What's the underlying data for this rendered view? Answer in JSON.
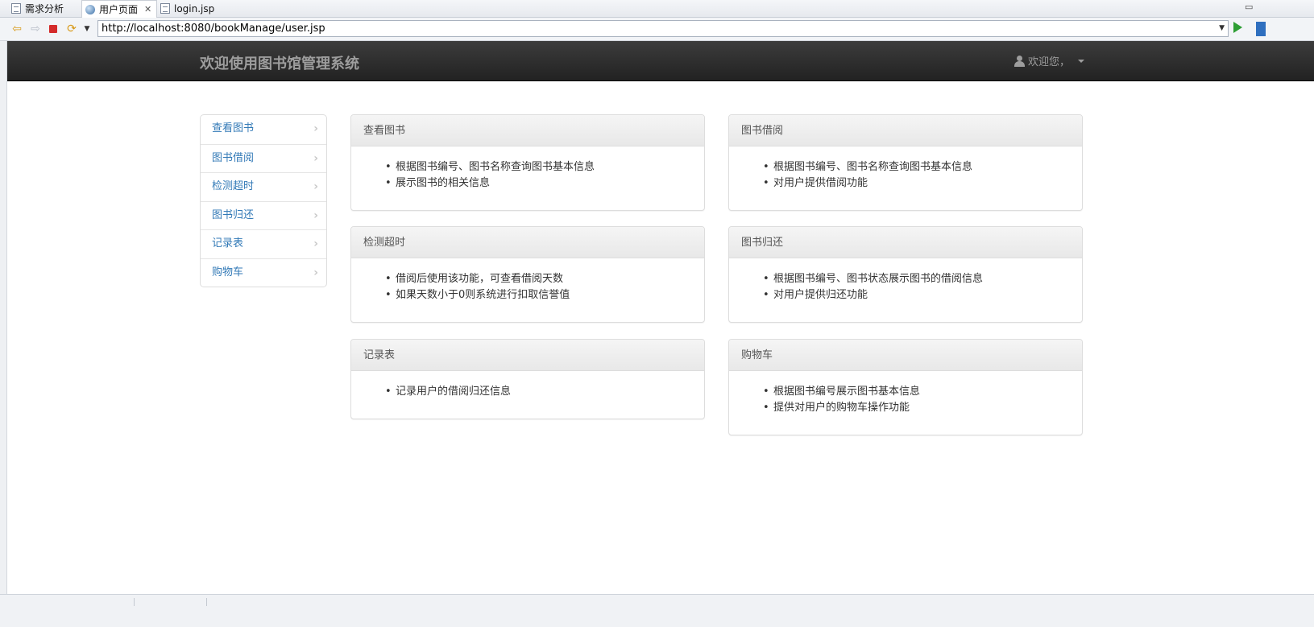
{
  "editor_tabs": [
    {
      "label": "需求分析",
      "icon": "document-icon",
      "active": false
    },
    {
      "label": "用户页面",
      "icon": "globe-icon",
      "active": true
    },
    {
      "label": "login.jsp",
      "icon": "jsp-file-icon",
      "active": false
    }
  ],
  "browser": {
    "url": "http://localhost:8080/bookManage/user.jsp"
  },
  "navbar": {
    "brand": "欢迎使用图书馆管理系统",
    "user_greeting": "欢迎您，"
  },
  "sidebar": {
    "items": [
      {
        "label": "查看图书"
      },
      {
        "label": "图书借阅"
      },
      {
        "label": "检测超时"
      },
      {
        "label": "图书归还"
      },
      {
        "label": "记录表"
      },
      {
        "label": "购物车"
      }
    ]
  },
  "panels": [
    {
      "title": "查看图书",
      "items": [
        "根据图书编号、图书名称查询图书基本信息",
        "展示图书的相关信息"
      ]
    },
    {
      "title": "图书借阅",
      "items": [
        "根据图书编号、图书名称查询图书基本信息",
        "对用户提供借阅功能"
      ]
    },
    {
      "title": "检测超时",
      "items": [
        "借阅后使用该功能，可查看借阅天数",
        "如果天数小于0则系统进行扣取信誉值"
      ]
    },
    {
      "title": "图书归还",
      "items": [
        "根据图书编号、图书状态展示图书的借阅信息",
        "对用户提供归还功能"
      ]
    },
    {
      "title": "记录表",
      "items": [
        "记录用户的借阅归还信息"
      ]
    },
    {
      "title": "购物车",
      "items": [
        "根据图书编号展示图书基本信息",
        "提供对用户的购物车操作功能"
      ]
    }
  ],
  "colors": {
    "navbar_bg": "#222222",
    "link": "#337ab7",
    "brand_text": "#9d9d9d"
  }
}
